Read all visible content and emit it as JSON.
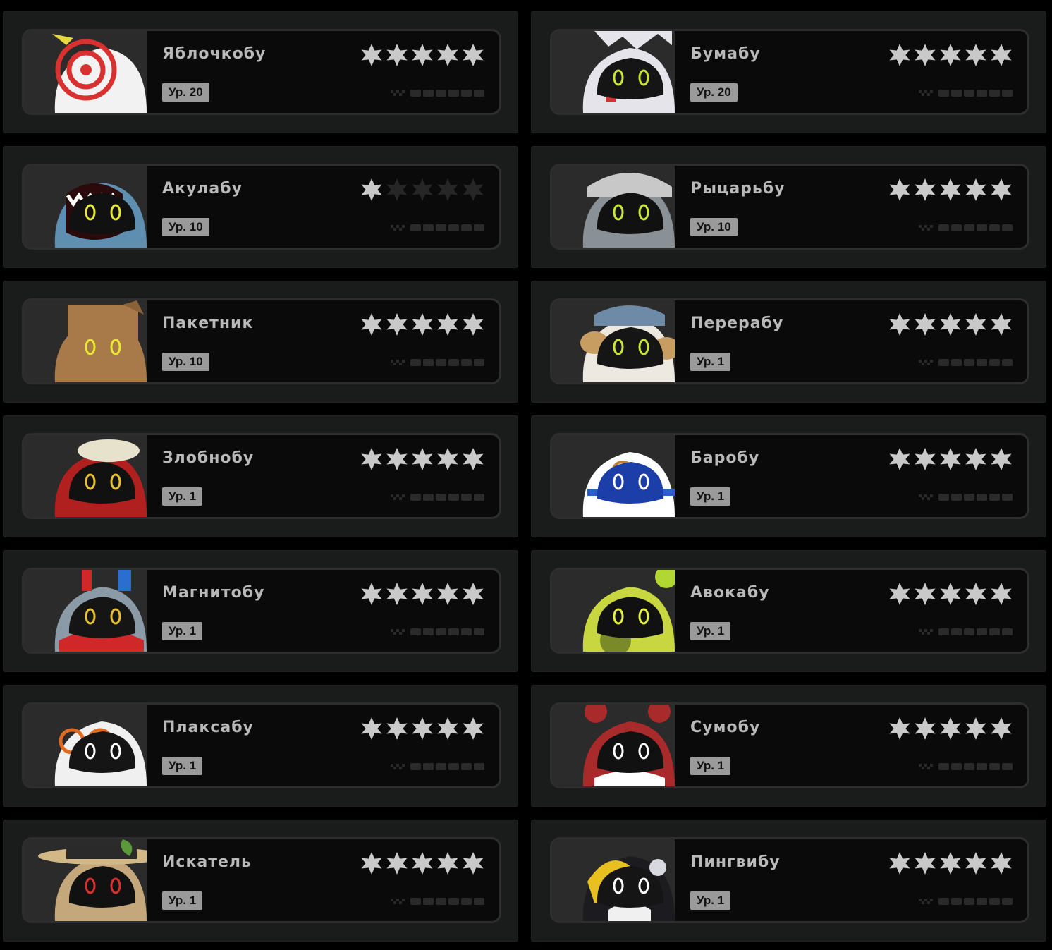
{
  "cards": [
    {
      "name": "Яблочкобу",
      "level": "Ур. 20",
      "stars": 5,
      "avatar": "apple-target-avatar"
    },
    {
      "name": "Бумабу",
      "level": "Ур. 20",
      "stars": 5,
      "avatar": "paper-sale-avatar"
    },
    {
      "name": "Акулабу",
      "level": "Ур. 10",
      "stars": 1,
      "avatar": "shark-avatar"
    },
    {
      "name": "Рыцарьбу",
      "level": "Ур. 10",
      "stars": 5,
      "avatar": "knight-helmet-avatar"
    },
    {
      "name": "Пакетник",
      "level": "Ур. 10",
      "stars": 5,
      "avatar": "paper-bag-avatar"
    },
    {
      "name": "Перерабу",
      "level": "Ур. 1",
      "stars": 5,
      "avatar": "recycler-bunny-avatar"
    },
    {
      "name": "Злобнобу",
      "level": "Ур. 1",
      "stars": 5,
      "avatar": "angry-hat-avatar"
    },
    {
      "name": "Баробу",
      "level": "Ур. 1",
      "stars": 5,
      "avatar": "blue-robot-avatar"
    },
    {
      "name": "Магнитобу",
      "level": "Ур. 1",
      "stars": 5,
      "avatar": "magnet-avatar"
    },
    {
      "name": "Авокабу",
      "level": "Ур. 1",
      "stars": 5,
      "avatar": "avocado-avatar"
    },
    {
      "name": "Плаксабу",
      "level": "Ур. 1",
      "stars": 5,
      "avatar": "crying-glasses-avatar"
    },
    {
      "name": "Сумобу",
      "level": "Ур. 1",
      "stars": 5,
      "avatar": "red-sumo-avatar"
    },
    {
      "name": "Искатель",
      "level": "Ур. 1",
      "stars": 5,
      "avatar": "explorer-hat-avatar"
    },
    {
      "name": "Пингвибу",
      "level": "Ур. 1",
      "stars": 5,
      "avatar": "penguin-avatar"
    }
  ],
  "max_stars": 5,
  "colors": {
    "page_bg": "#000000",
    "slot_bg": "#1a1b1b",
    "card_bg": "#0a0a0a",
    "card_border": "#2e2e2e",
    "name_text": "#b9b9b9",
    "level_badge_bg": "#9a9a9a",
    "star_filled": "#c9c9c9",
    "star_empty": "#262626"
  }
}
